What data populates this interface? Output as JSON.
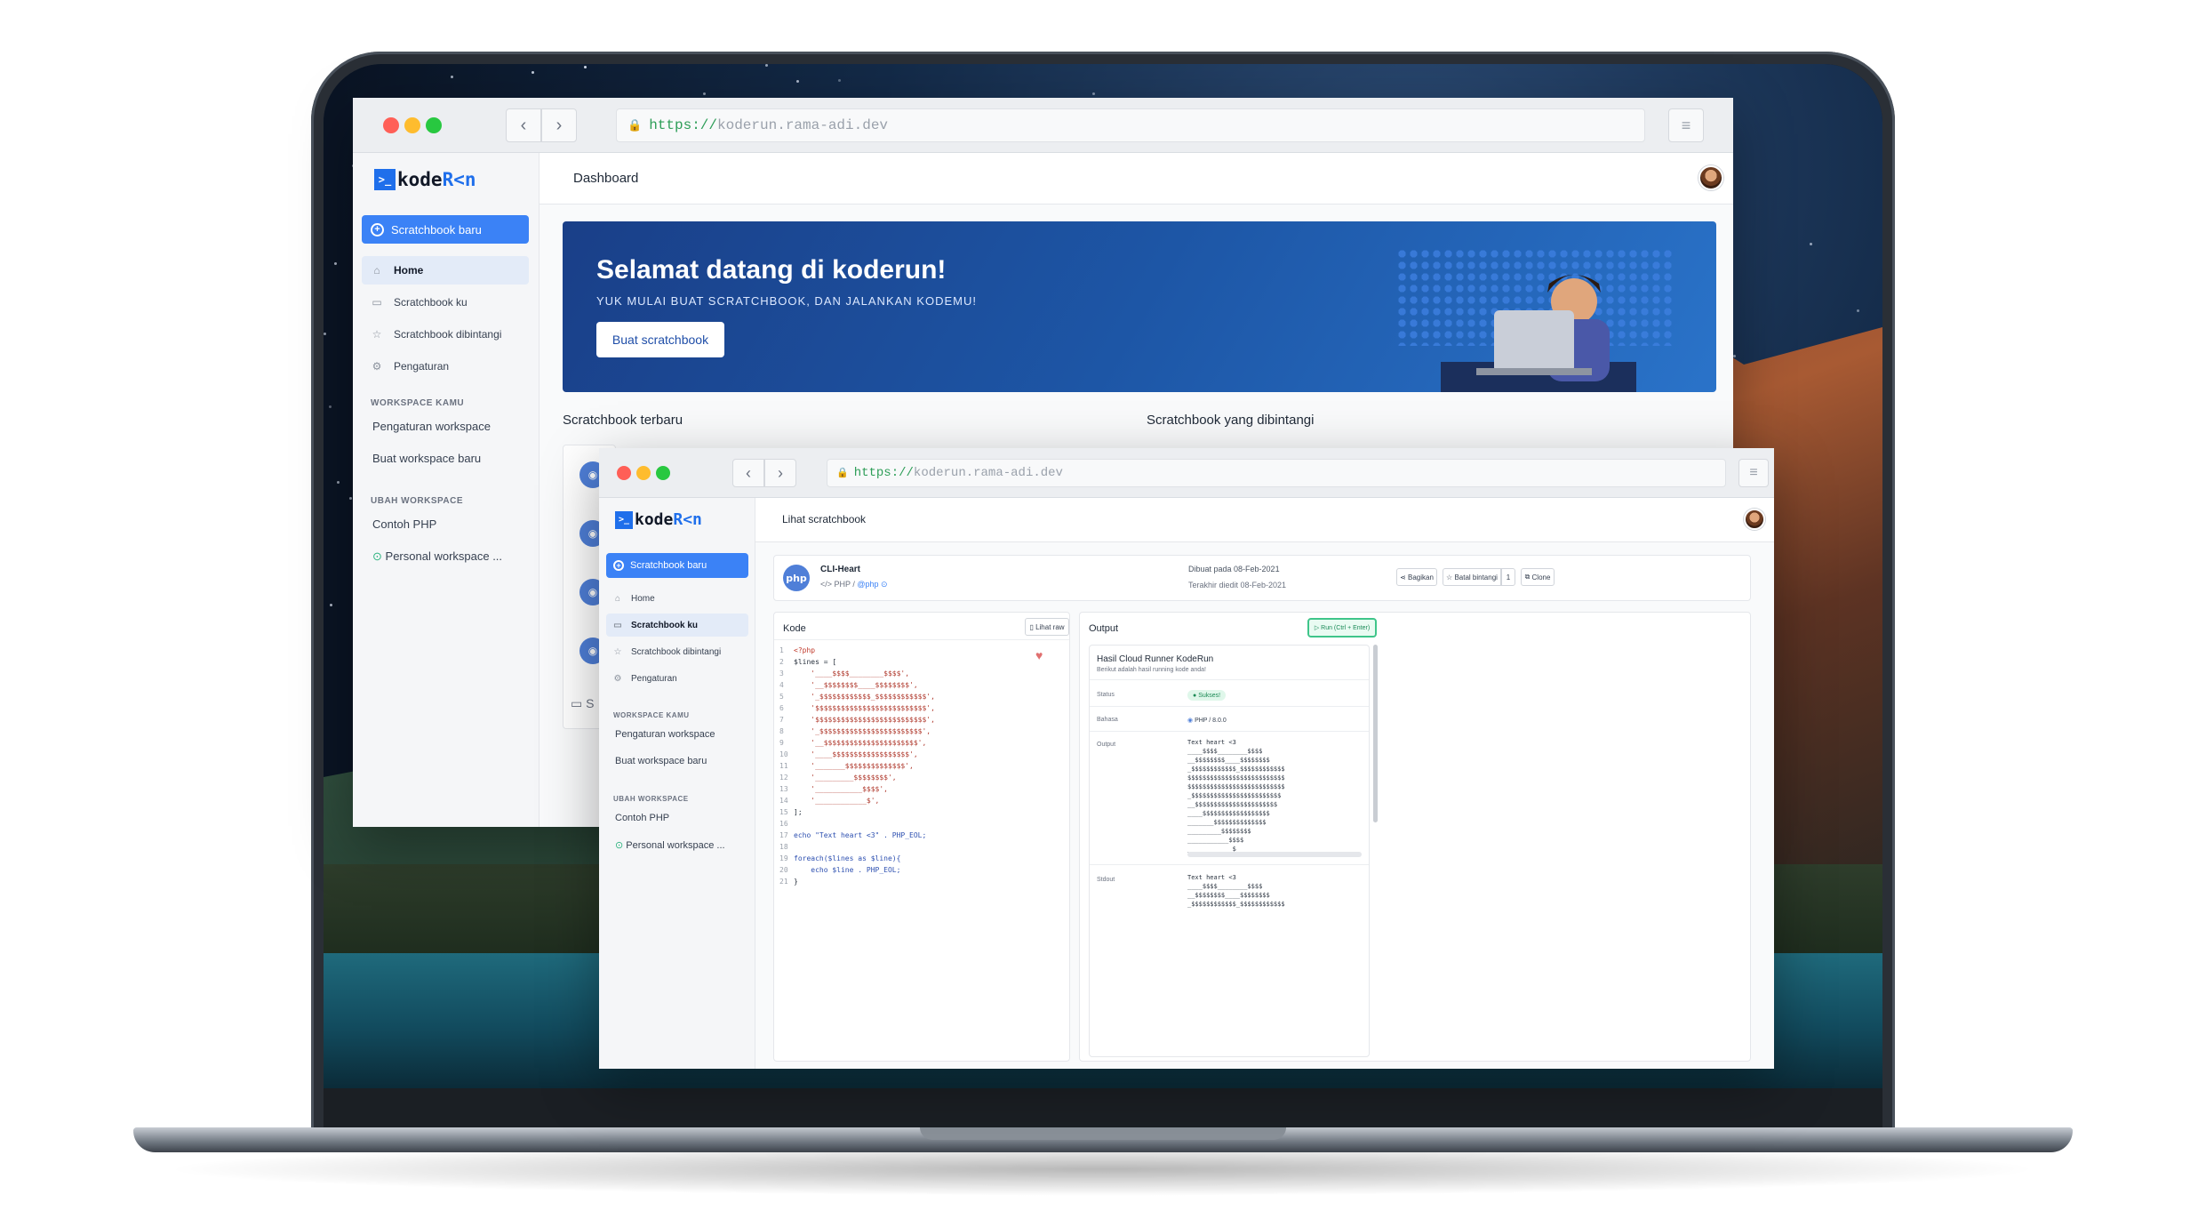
{
  "browser": {
    "url_scheme": "https://",
    "url_host": "koderun.rama-adi.dev"
  },
  "logo": {
    "prefix": ">_",
    "text": "kode",
    "text_run": "R<n"
  },
  "sidebar": {
    "new_button": "Scratchbook baru",
    "items": [
      {
        "label": "Home",
        "icon": "home-icon"
      },
      {
        "label": "Scratchbook ku",
        "icon": "briefcase-icon"
      },
      {
        "label": "Scratchbook dibintangi",
        "icon": "star-icon"
      },
      {
        "label": "Pengaturan",
        "icon": "gear-icon"
      }
    ],
    "workspace_section": "WORKSPACE KAMU",
    "workspace_items": [
      "Pengaturan workspace",
      "Buat workspace baru"
    ],
    "change_section": "UBAH WORKSPACE",
    "change_items": [
      "Contoh PHP",
      "Personal workspace ..."
    ]
  },
  "dashboard": {
    "title": "Dashboard",
    "hero_title": "Selamat datang di koderun!",
    "hero_subtitle": "YUK MULAI BUAT SCRATCHBOOK, DAN JALANKAN KODEMU!",
    "hero_button": "Buat scratchbook",
    "recent_title": "Scratchbook terbaru",
    "starred_title": "Scratchbook yang dibintangi",
    "recent_tail_label": "S"
  },
  "viewer": {
    "title": "Lihat scratchbook",
    "name": "CLI-Heart",
    "lang": "PHP",
    "author": "@php",
    "created": "Dibuat pada 08-Feb-2021",
    "edited": "Terakhir diedit 08-Feb-2021",
    "share": "Bagikan",
    "unstar": "Batal bintangi",
    "star_count": "1",
    "clone": "Clone",
    "code_title": "Kode",
    "raw_button": "Lihat raw",
    "output_title": "Output",
    "run_button": "Run (Ctrl + Enter)",
    "result_title": "Hasil Cloud Runner KodeRun",
    "result_sub": "Berikut adalah hasil running kode anda!",
    "status_label": "Status",
    "status_value": "Sukses!",
    "lang_label": "Bahasa",
    "lang_value": "PHP / 8.0.0",
    "output_label": "Output",
    "stdout_label": "Stdout"
  },
  "code_lines": [
    "<?php",
    "$lines = [",
    "    '____$$$$________$$$$',",
    "    '__$$$$$$$$____$$$$$$$$',",
    "    '_$$$$$$$$$$$$_$$$$$$$$$$$$',",
    "    '$$$$$$$$$$$$$$$$$$$$$$$$$$',",
    "    '$$$$$$$$$$$$$$$$$$$$$$$$$$',",
    "    '_$$$$$$$$$$$$$$$$$$$$$$$$',",
    "    '__$$$$$$$$$$$$$$$$$$$$$$',",
    "    '____$$$$$$$$$$$$$$$$$$',",
    "    '_______$$$$$$$$$$$$$$',",
    "    '_________$$$$$$$$',",
    "    '___________$$$$',",
    "    '____________$',",
    "];",
    "",
    "echo \"Text heart <3\" . PHP_EOL;",
    "",
    "foreach($lines as $line){",
    "    echo $line . PHP_EOL;",
    "}"
  ],
  "output_lines": [
    "Text heart <3",
    "____$$$$________$$$$",
    "__$$$$$$$$____$$$$$$$$",
    "_$$$$$$$$$$$$_$$$$$$$$$$$$",
    "$$$$$$$$$$$$$$$$$$$$$$$$$$",
    "$$$$$$$$$$$$$$$$$$$$$$$$$$",
    "_$$$$$$$$$$$$$$$$$$$$$$$$",
    "__$$$$$$$$$$$$$$$$$$$$$$",
    "____$$$$$$$$$$$$$$$$$$",
    "_______$$$$$$$$$$$$$$",
    "_________$$$$$$$$",
    "___________$$$$",
    "____________$"
  ],
  "stdout_lines": [
    "Text heart <3",
    "____$$$$________$$$$",
    "__$$$$$$$$____$$$$$$$$",
    "_$$$$$$$$$$$$_$$$$$$$$$$$$"
  ]
}
